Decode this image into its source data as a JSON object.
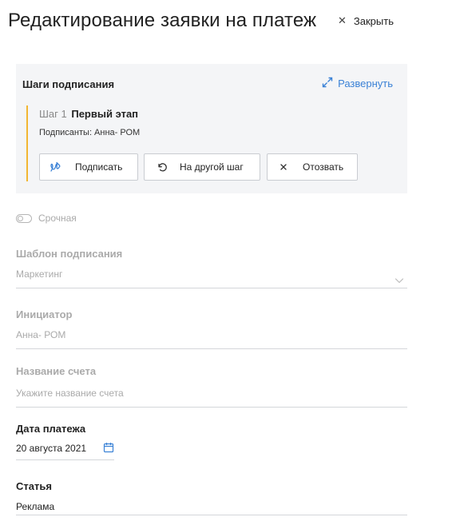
{
  "header": {
    "title": "Редактирование заявки на платеж",
    "close_label": "Закрыть"
  },
  "signing": {
    "title": "Шаги подписания",
    "expand_label": "Развернуть",
    "step_prefix": "Шаг 1",
    "step_name": "Первый этап",
    "signers": "Подписанты: Анна- РОМ",
    "buttons": {
      "sign": "Подписать",
      "other_step": "На другой шаг",
      "revoke": "Отозвать"
    },
    "accent_color": "#f2b632"
  },
  "urgent": {
    "label": "Срочная",
    "checked": false
  },
  "template": {
    "label": "Шаблон подписания",
    "value": "Маркетинг"
  },
  "initiator": {
    "label": "Инициатор",
    "value": "Анна- РОМ"
  },
  "invoice": {
    "label": "Название счета",
    "placeholder": "Укажите название счета"
  },
  "payment_date": {
    "label": "Дата платежа",
    "value": "20 августа 2021"
  },
  "article": {
    "label": "Статья",
    "value": "Реклама"
  }
}
